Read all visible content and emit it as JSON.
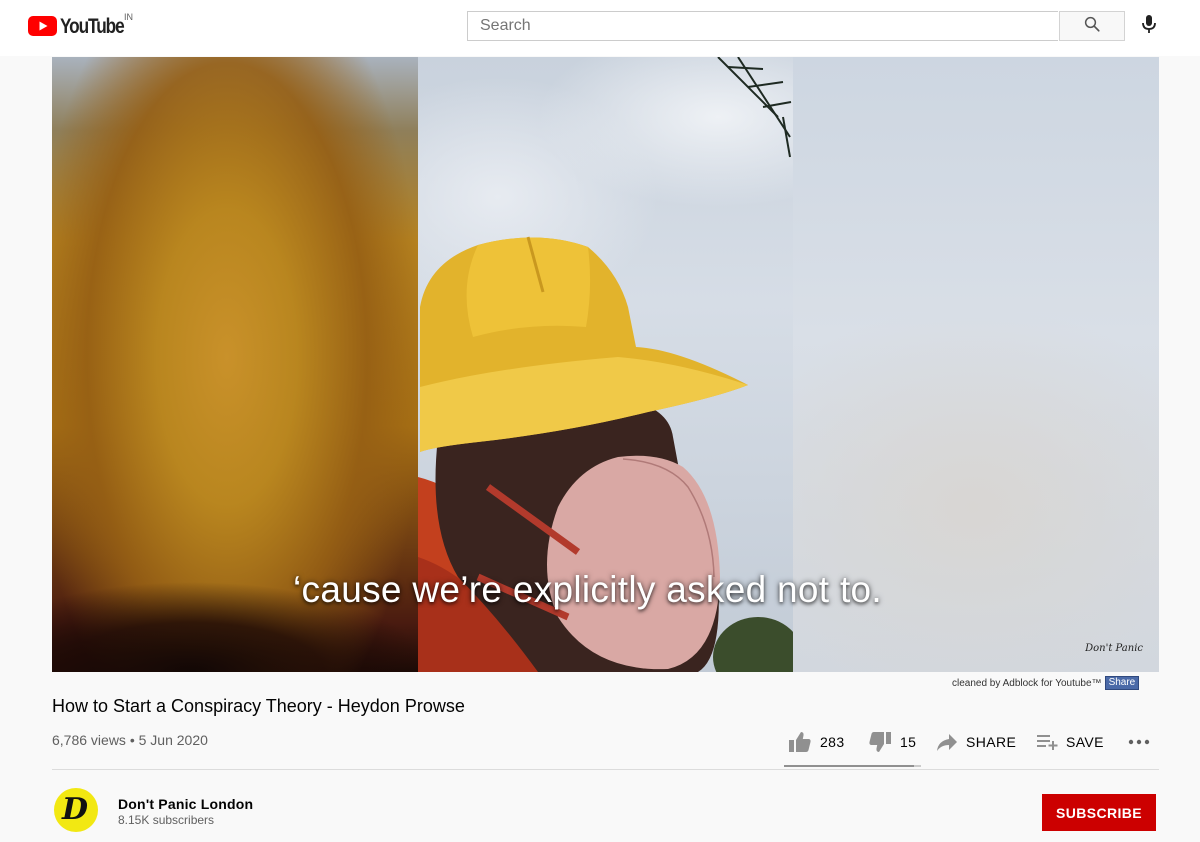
{
  "masthead": {
    "logo_text": "YouTube",
    "country_code": "IN",
    "search_placeholder": "Search",
    "search_value": "",
    "icons": {
      "logo": "youtube-play-icon",
      "search": "search-icon",
      "mic": "microphone-icon"
    }
  },
  "video": {
    "caption": "‘cause we’re explicitly asked not to.",
    "watermark": "Don't Panic",
    "adblock_text": "cleaned by Adblock for Youtube™",
    "adblock_share": "Share"
  },
  "info": {
    "title": "How to Start a Conspiracy Theory - Heydon Prowse",
    "views": "6,786 views",
    "separator": "•",
    "date": "5 Jun 2020",
    "likes": "283",
    "dislikes": "15",
    "like_ratio": 0.95,
    "share_label": "SHARE",
    "save_label": "SAVE",
    "icons": {
      "like": "thumbs-up-icon",
      "dislike": "thumbs-down-icon",
      "share": "share-arrow-icon",
      "save": "playlist-add-icon",
      "more": "more-dots-icon"
    }
  },
  "channel": {
    "name": "Don't Panic London",
    "subscribers": "8.15K subscribers",
    "avatar_letter": "D",
    "avatar_color": "#f2e812",
    "subscribe_label": "SUBSCRIBE",
    "subscribe_color": "#cc0000"
  }
}
